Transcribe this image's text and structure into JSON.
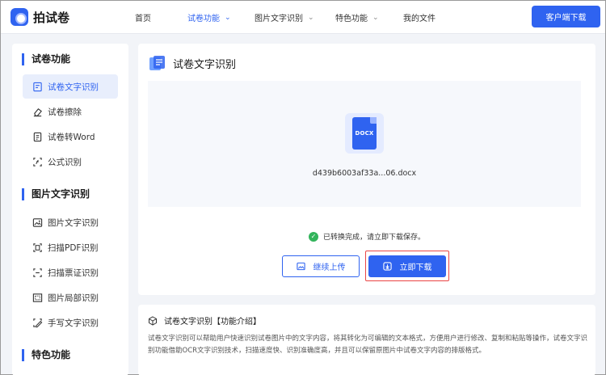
{
  "header": {
    "logo_text": "拍试卷",
    "nav": [
      {
        "label": "首页",
        "has_dropdown": false,
        "active": false
      },
      {
        "label": "试卷功能",
        "has_dropdown": true,
        "active": true
      },
      {
        "label": "图片文字识别",
        "has_dropdown": true,
        "active": false
      },
      {
        "label": "特色功能",
        "has_dropdown": true,
        "active": false
      },
      {
        "label": "我的文件",
        "has_dropdown": false,
        "active": false
      }
    ],
    "client_download": "客户端下载"
  },
  "sidebar": {
    "sections": [
      {
        "title": "试卷功能",
        "items": [
          {
            "label": "试卷文字识别",
            "icon": "exam-text-icon",
            "active": true
          },
          {
            "label": "试卷擦除",
            "icon": "eraser-icon",
            "active": false
          },
          {
            "label": "试卷转Word",
            "icon": "word-icon",
            "active": false
          },
          {
            "label": "公式识别",
            "icon": "formula-icon",
            "active": false
          }
        ]
      },
      {
        "title": "图片文字识别",
        "items": [
          {
            "label": "图片文字识别",
            "icon": "image-text-icon",
            "active": false
          },
          {
            "label": "扫描PDF识别",
            "icon": "pdf-scan-icon",
            "active": false
          },
          {
            "label": "扫描票证识别",
            "icon": "ticket-scan-icon",
            "active": false
          },
          {
            "label": "图片局部识别",
            "icon": "image-crop-icon",
            "active": false
          },
          {
            "label": "手写文字识别",
            "icon": "handwriting-icon",
            "active": false
          }
        ]
      },
      {
        "title": "特色功能",
        "items": []
      }
    ]
  },
  "main": {
    "title": "试卷文字识别",
    "file": {
      "type_label": "DOCX",
      "name": "d439b6003af33a...06.docx"
    },
    "status_text": "已转换完成，请立即下载保存。",
    "continue_label": "继续上传",
    "download_label": "立即下载"
  },
  "intro": {
    "title": "试卷文字识别【功能介绍】",
    "text": "试卷文字识别可以帮助用户快速识别试卷图片中的文字内容，将其转化为可编辑的文本格式，方便用户进行修改、复制和粘贴等操作，试卷文字识别功能借助OCR文字识别技术，扫描速度快、识别准确度高，并且可以保留原图片中试卷文字内容的排版格式。"
  },
  "colors": {
    "accent": "#2f63f0",
    "success": "#32b45b",
    "highlight": "#e94545"
  }
}
